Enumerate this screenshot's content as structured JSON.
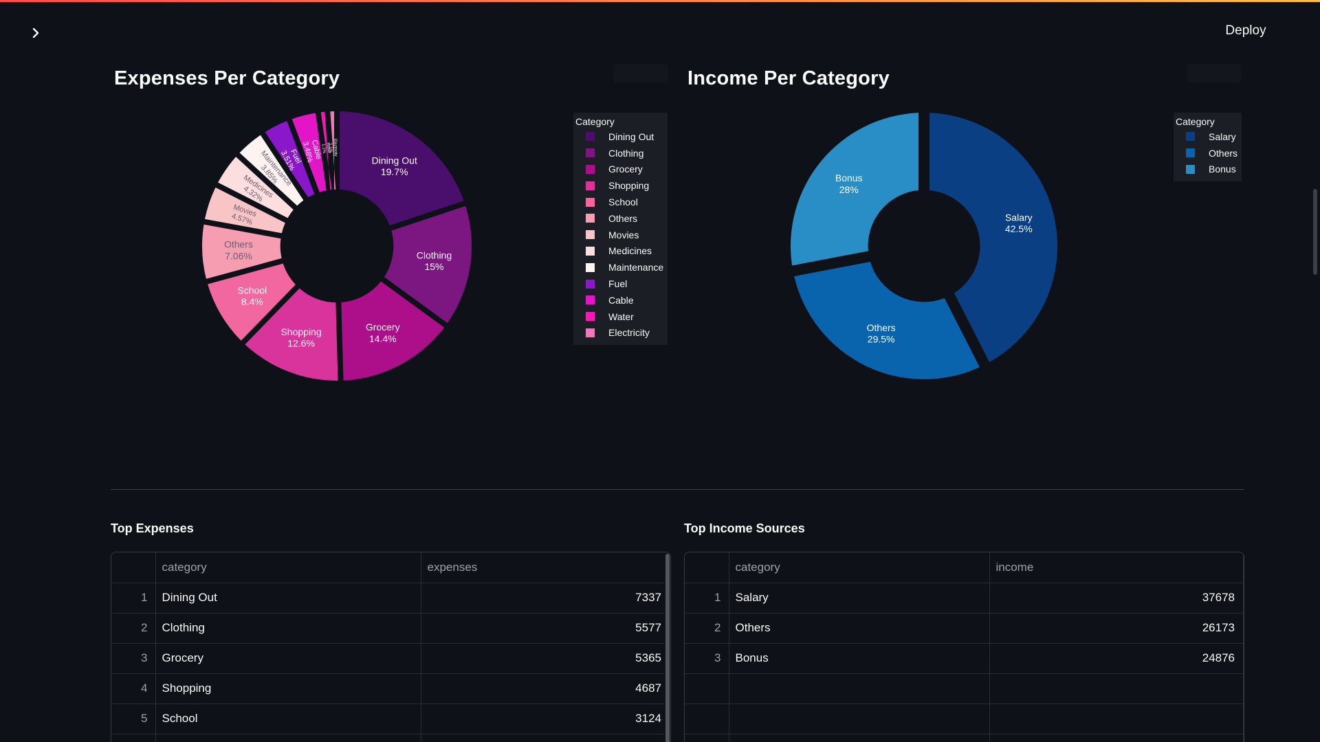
{
  "app": {
    "deploy_label": "Deploy"
  },
  "colors": {
    "accent_start": "#ff4b4b",
    "accent_end": "#ffbd45",
    "background": "#0e1117"
  },
  "icons": {
    "sidebar_toggle": "chevron-right-icon"
  },
  "expenses_chart": {
    "title": "Expenses Per Category",
    "legend_title": "Category",
    "chart_data": {
      "type": "pie",
      "hole": 0.42,
      "categories": [
        "Dining Out",
        "Clothing",
        "Grocery",
        "Shopping",
        "School",
        "Others",
        "Movies",
        "Medicines",
        "Maintenance",
        "Fuel",
        "Cable",
        "Water",
        "Electricity"
      ],
      "values": [
        19.7,
        15,
        14.4,
        12.6,
        8.4,
        7.06,
        4.57,
        4.32,
        3.85,
        3.51,
        3.48,
        1.1,
        1.1
      ],
      "slice_labels": [
        [
          "Dining Out",
          "19.7%"
        ],
        [
          "Clothing",
          "15%"
        ],
        [
          "Grocery",
          "14.4%"
        ],
        [
          "Shopping",
          "12.6%"
        ],
        [
          "School",
          "8.4%"
        ],
        [
          "Others",
          "7.06%"
        ],
        [
          "Movies",
          "4.57%"
        ],
        [
          "Medicines",
          "4.32%"
        ],
        [
          "Maintenance",
          "3.85%"
        ],
        [
          "Fuel",
          "3.51%"
        ],
        [
          "Cable",
          "3.48%"
        ],
        [
          "Water",
          "1.1%"
        ],
        [
          "Electricity",
          "1.1%"
        ]
      ],
      "colors": [
        "#4a0e6d",
        "#7c1781",
        "#ad0f8a",
        "#d8349b",
        "#f2679f",
        "#f79db1",
        "#f9c4c6",
        "#fbdedd",
        "#fdf3f1",
        "#8a17c9",
        "#e316c7",
        "#f21ab3",
        "#ec7ab8"
      ]
    }
  },
  "income_chart": {
    "title": "Income Per Category",
    "legend_title": "Category",
    "chart_data": {
      "type": "pie",
      "hole": 0.42,
      "categories": [
        "Salary",
        "Others",
        "Bonus"
      ],
      "values": [
        42.5,
        29.5,
        28
      ],
      "slice_labels": [
        [
          "Salary",
          "42.5%"
        ],
        [
          "Others",
          "29.5%"
        ],
        [
          "Bonus",
          "28%"
        ]
      ],
      "colors": [
        "#0b3f84",
        "#0a64ad",
        "#2a8ec6"
      ]
    }
  },
  "top_expenses": {
    "title": "Top Expenses",
    "columns": [
      "category",
      "expenses"
    ],
    "rows": [
      {
        "idx": "1",
        "category": "Dining Out",
        "value": "7337"
      },
      {
        "idx": "2",
        "category": "Clothing",
        "value": "5577"
      },
      {
        "idx": "3",
        "category": "Grocery",
        "value": "5365"
      },
      {
        "idx": "4",
        "category": "Shopping",
        "value": "4687"
      },
      {
        "idx": "5",
        "category": "School",
        "value": "3124"
      }
    ]
  },
  "top_income": {
    "title": "Top Income Sources",
    "columns": [
      "category",
      "income"
    ],
    "rows": [
      {
        "idx": "1",
        "category": "Salary",
        "value": "37678"
      },
      {
        "idx": "2",
        "category": "Others",
        "value": "26173"
      },
      {
        "idx": "3",
        "category": "Bonus",
        "value": "24876"
      }
    ]
  }
}
